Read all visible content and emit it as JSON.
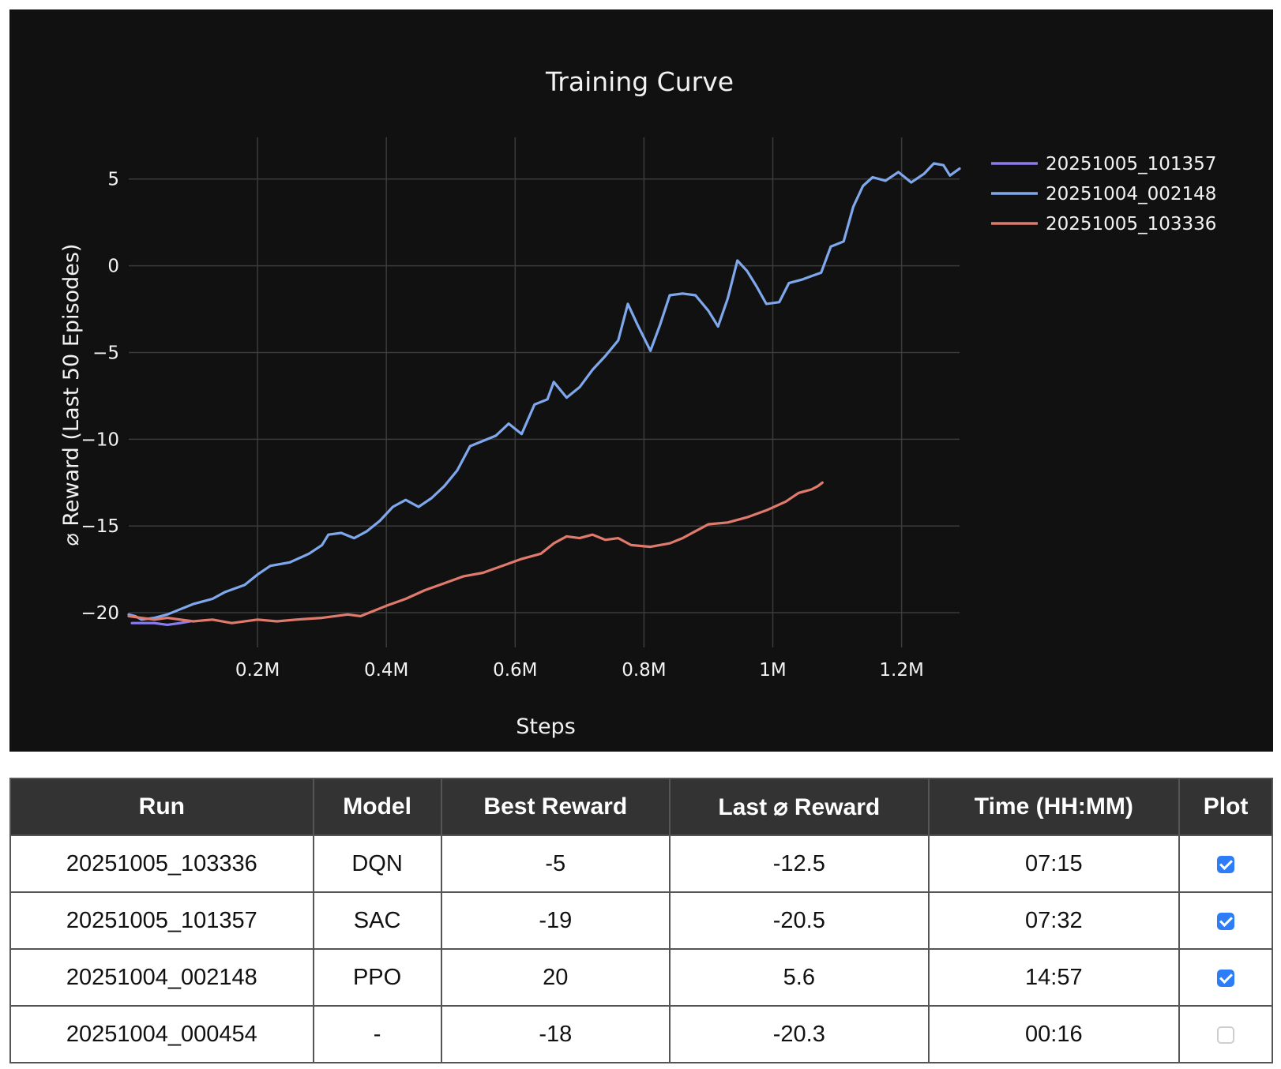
{
  "chart_data": {
    "type": "line",
    "title": "Training Curve",
    "xlabel": "Steps",
    "ylabel": "⌀ Reward (Last 50 Episodes)",
    "xlim": [
      0,
      1290000
    ],
    "ylim": [
      -22,
      7.4
    ],
    "x_ticks": [
      {
        "value": 200000,
        "label": "0.2M"
      },
      {
        "value": 400000,
        "label": "0.4M"
      },
      {
        "value": 600000,
        "label": "0.6M"
      },
      {
        "value": 800000,
        "label": "0.8M"
      },
      {
        "value": 1000000,
        "label": "1M"
      },
      {
        "value": 1200000,
        "label": "1.2M"
      }
    ],
    "y_ticks": [
      {
        "value": 5,
        "label": "5"
      },
      {
        "value": 0,
        "label": "0"
      },
      {
        "value": -5,
        "label": "−5"
      },
      {
        "value": -10,
        "label": "−10"
      },
      {
        "value": -15,
        "label": "−15"
      },
      {
        "value": -20,
        "label": "−20"
      }
    ],
    "grid": true,
    "legend_position": "top-right",
    "series": [
      {
        "name": "20251005_101357",
        "color": "#8a7cf0",
        "points": [
          [
            5000,
            -20.6
          ],
          [
            20000,
            -20.6
          ],
          [
            40000,
            -20.6
          ],
          [
            60000,
            -20.7
          ],
          [
            80000,
            -20.6
          ],
          [
            95000,
            -20.5
          ]
        ]
      },
      {
        "name": "20251004_002148",
        "color": "#7fa8ec",
        "points": [
          [
            0,
            -20.1
          ],
          [
            10000,
            -20.2
          ],
          [
            20000,
            -20.4
          ],
          [
            40000,
            -20.3
          ],
          [
            60000,
            -20.1
          ],
          [
            80000,
            -19.8
          ],
          [
            100000,
            -19.5
          ],
          [
            130000,
            -19.2
          ],
          [
            150000,
            -18.8
          ],
          [
            180000,
            -18.4
          ],
          [
            200000,
            -17.8
          ],
          [
            220000,
            -17.3
          ],
          [
            250000,
            -17.1
          ],
          [
            280000,
            -16.6
          ],
          [
            300000,
            -16.1
          ],
          [
            310000,
            -15.5
          ],
          [
            330000,
            -15.4
          ],
          [
            350000,
            -15.7
          ],
          [
            370000,
            -15.3
          ],
          [
            390000,
            -14.7
          ],
          [
            410000,
            -13.9
          ],
          [
            430000,
            -13.5
          ],
          [
            450000,
            -13.9
          ],
          [
            470000,
            -13.4
          ],
          [
            490000,
            -12.7
          ],
          [
            510000,
            -11.8
          ],
          [
            530000,
            -10.4
          ],
          [
            550000,
            -10.1
          ],
          [
            570000,
            -9.8
          ],
          [
            590000,
            -9.1
          ],
          [
            610000,
            -9.7
          ],
          [
            630000,
            -8.0
          ],
          [
            650000,
            -7.7
          ],
          [
            660000,
            -6.7
          ],
          [
            680000,
            -7.6
          ],
          [
            700000,
            -7.0
          ],
          [
            720000,
            -6.0
          ],
          [
            740000,
            -5.2
          ],
          [
            760000,
            -4.3
          ],
          [
            775000,
            -2.2
          ],
          [
            790000,
            -3.4
          ],
          [
            810000,
            -4.9
          ],
          [
            825000,
            -3.4
          ],
          [
            840000,
            -1.7
          ],
          [
            860000,
            -1.6
          ],
          [
            880000,
            -1.7
          ],
          [
            900000,
            -2.6
          ],
          [
            915000,
            -3.5
          ],
          [
            930000,
            -1.9
          ],
          [
            945000,
            0.3
          ],
          [
            960000,
            -0.3
          ],
          [
            975000,
            -1.2
          ],
          [
            990000,
            -2.2
          ],
          [
            1010000,
            -2.1
          ],
          [
            1025000,
            -1.0
          ],
          [
            1045000,
            -0.8
          ],
          [
            1060000,
            -0.6
          ],
          [
            1075000,
            -0.4
          ],
          [
            1090000,
            1.1
          ],
          [
            1110000,
            1.4
          ],
          [
            1125000,
            3.4
          ],
          [
            1140000,
            4.6
          ],
          [
            1155000,
            5.1
          ],
          [
            1175000,
            4.9
          ],
          [
            1195000,
            5.4
          ],
          [
            1215000,
            4.8
          ],
          [
            1235000,
            5.3
          ],
          [
            1250000,
            5.9
          ],
          [
            1265000,
            5.8
          ],
          [
            1275000,
            5.2
          ],
          [
            1290000,
            5.6
          ]
        ]
      },
      {
        "name": "20251005_103336",
        "color": "#e07a6c",
        "points": [
          [
            0,
            -20.2
          ],
          [
            40000,
            -20.4
          ],
          [
            60000,
            -20.3
          ],
          [
            100000,
            -20.5
          ],
          [
            130000,
            -20.4
          ],
          [
            160000,
            -20.6
          ],
          [
            200000,
            -20.4
          ],
          [
            230000,
            -20.5
          ],
          [
            260000,
            -20.4
          ],
          [
            300000,
            -20.3
          ],
          [
            340000,
            -20.1
          ],
          [
            360000,
            -20.2
          ],
          [
            380000,
            -19.9
          ],
          [
            400000,
            -19.6
          ],
          [
            430000,
            -19.2
          ],
          [
            460000,
            -18.7
          ],
          [
            490000,
            -18.3
          ],
          [
            520000,
            -17.9
          ],
          [
            550000,
            -17.7
          ],
          [
            580000,
            -17.3
          ],
          [
            610000,
            -16.9
          ],
          [
            640000,
            -16.6
          ],
          [
            660000,
            -16.0
          ],
          [
            680000,
            -15.6
          ],
          [
            700000,
            -15.7
          ],
          [
            720000,
            -15.5
          ],
          [
            740000,
            -15.8
          ],
          [
            760000,
            -15.7
          ],
          [
            780000,
            -16.1
          ],
          [
            810000,
            -16.2
          ],
          [
            840000,
            -16.0
          ],
          [
            860000,
            -15.7
          ],
          [
            880000,
            -15.3
          ],
          [
            900000,
            -14.9
          ],
          [
            930000,
            -14.8
          ],
          [
            960000,
            -14.5
          ],
          [
            990000,
            -14.1
          ],
          [
            1020000,
            -13.6
          ],
          [
            1040000,
            -13.1
          ],
          [
            1060000,
            -12.9
          ],
          [
            1070000,
            -12.7
          ],
          [
            1077000,
            -12.5
          ]
        ]
      }
    ]
  },
  "table": {
    "headers": [
      "Run",
      "Model",
      "Best Reward",
      "Last ⌀ Reward",
      "Time (HH:MM)",
      "Plot"
    ],
    "rows": [
      {
        "run": "20251005_103336",
        "model": "DQN",
        "best": "-5",
        "last": "-12.5",
        "time": "07:15",
        "plot": true
      },
      {
        "run": "20251005_101357",
        "model": "SAC",
        "best": "-19",
        "last": "-20.5",
        "time": "07:32",
        "plot": true
      },
      {
        "run": "20251004_002148",
        "model": "PPO",
        "best": "20",
        "last": "5.6",
        "time": "14:57",
        "plot": true
      },
      {
        "run": "20251004_000454",
        "model": "-",
        "best": "-18",
        "last": "-20.3",
        "time": "00:16",
        "plot": false
      }
    ]
  }
}
